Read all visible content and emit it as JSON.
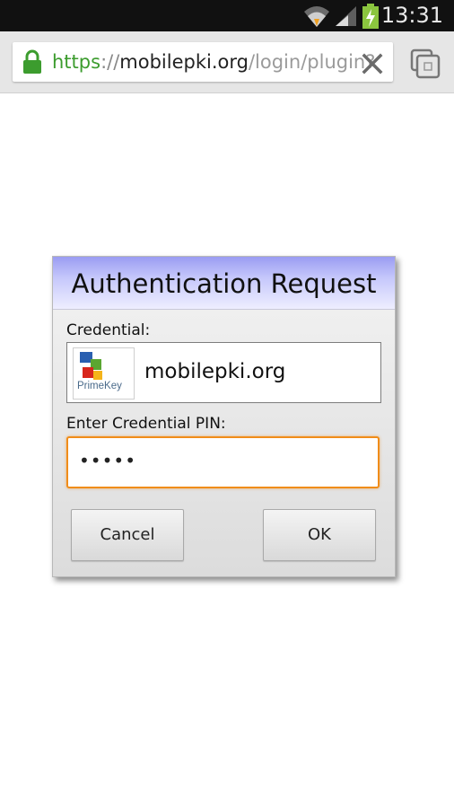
{
  "status_bar": {
    "time": "13:31",
    "icons": [
      "wifi-icon",
      "signal-icon",
      "battery-charging-icon"
    ]
  },
  "browser": {
    "url": {
      "scheme": "https",
      "separator": "://",
      "host": "mobilepki.org",
      "path": "/login/plugin?"
    },
    "icons": [
      "lock-icon",
      "clear-icon",
      "tabs-icon"
    ],
    "colors": {
      "secure_scheme": "#3c9c2e"
    }
  },
  "dialog": {
    "title": "Authentication Request",
    "credential_label": "Credential:",
    "credential": {
      "logo_text": "PrimeKey",
      "name": "mobilepki.org"
    },
    "pin_label": "Enter Credential PIN:",
    "pin_value": "•••••",
    "cancel_label": "Cancel",
    "ok_label": "OK",
    "colors": {
      "focus_border": "#f08d1a",
      "header_gradient_top": "#9a9cf2"
    }
  }
}
